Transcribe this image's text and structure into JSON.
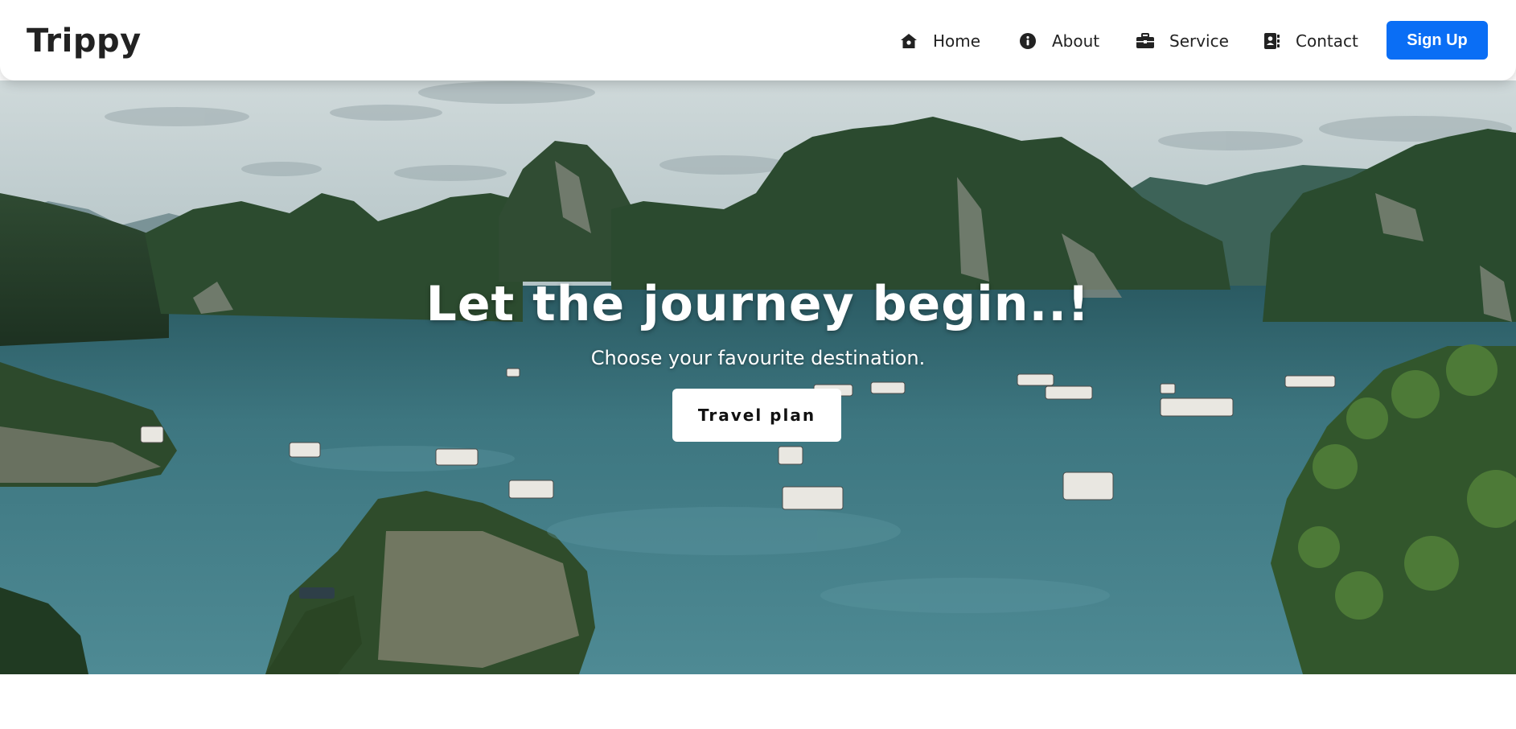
{
  "brand": {
    "name": "Trippy"
  },
  "nav": {
    "items": [
      {
        "label": "Home",
        "icon": "home-icon"
      },
      {
        "label": "About",
        "icon": "info-icon"
      },
      {
        "label": "Service",
        "icon": "briefcase-icon"
      },
      {
        "label": "Contact",
        "icon": "contact-book-icon"
      }
    ],
    "signup_label": "Sign Up"
  },
  "hero": {
    "title": "Let the journey begin..!",
    "subtitle": "Choose your favourite destination.",
    "cta_label": "Travel plan",
    "background": "bay-with-limestone-islands-and-boats"
  },
  "colors": {
    "accent": "#0a6ef5",
    "text": "#222222",
    "navbar_bg": "#ffffff"
  }
}
